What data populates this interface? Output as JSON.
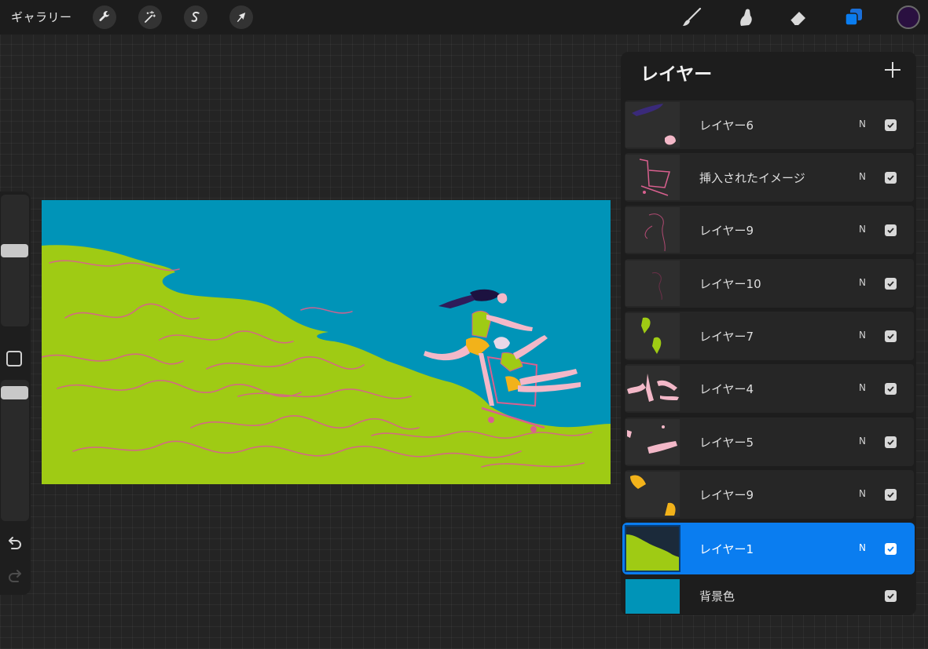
{
  "toolbar": {
    "gallery_label": "ギャラリー",
    "left_tools": [
      {
        "icon": "wrench-icon",
        "name": "actions"
      },
      {
        "icon": "magic-wand-icon",
        "name": "adjustments"
      },
      {
        "icon": "selection-s-icon",
        "name": "selection"
      },
      {
        "icon": "cursor-arrow-icon",
        "name": "transform"
      }
    ],
    "right_tools": [
      {
        "icon": "brush-icon",
        "name": "paint"
      },
      {
        "icon": "smudge-icon",
        "name": "smudge"
      },
      {
        "icon": "eraser-icon",
        "name": "erase"
      },
      {
        "icon": "layers-icon",
        "name": "layers",
        "active": true
      }
    ],
    "current_color": "#2a1040"
  },
  "sidebar": {
    "brush_size": 0.58,
    "opacity": 0.95,
    "icons": [
      "square-modify-icon",
      "undo-icon",
      "redo-icon"
    ]
  },
  "layers": {
    "title": "レイヤー",
    "add_icon": "plus-icon",
    "items": [
      {
        "name": "レイヤー6",
        "blend": "N",
        "visible": true,
        "active": false
      },
      {
        "name": "挿入されたイメージ",
        "blend": "N",
        "visible": true,
        "active": false
      },
      {
        "name": "レイヤー9",
        "blend": "N",
        "visible": true,
        "active": false
      },
      {
        "name": "レイヤー10",
        "blend": "N",
        "visible": true,
        "active": false
      },
      {
        "name": "レイヤー7",
        "blend": "N",
        "visible": true,
        "active": false
      },
      {
        "name": "レイヤー4",
        "blend": "N",
        "visible": true,
        "active": false
      },
      {
        "name": "レイヤー5",
        "blend": "N",
        "visible": true,
        "active": false
      },
      {
        "name": "レイヤー9",
        "blend": "N",
        "visible": true,
        "active": false
      },
      {
        "name": "レイヤー1",
        "blend": "N",
        "visible": true,
        "active": true
      }
    ],
    "background": {
      "name": "背景色",
      "color": "#0094b8",
      "visible": true
    }
  },
  "colors": {
    "sky": "#0094b8",
    "grass": "#9fcb14",
    "accent": "#0a7df0",
    "pink": "#e0609a"
  }
}
